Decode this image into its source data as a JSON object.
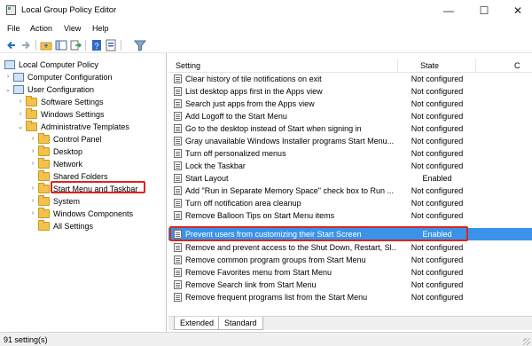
{
  "window": {
    "title": "Local Group Policy Editor",
    "minimize": "—",
    "maximize": "☐",
    "close": "✕"
  },
  "menu": [
    "File",
    "Action",
    "View",
    "Help"
  ],
  "toolbar": [
    "back-icon",
    "forward-icon",
    "folder-up-icon",
    "show-hide-tree-icon",
    "export-list-icon",
    "help-icon",
    "properties-icon",
    "filter-icon"
  ],
  "tree": {
    "root": "Local Computer Policy",
    "items": [
      {
        "label": "Computer Configuration",
        "caret": "›",
        "icon": "computer-icon"
      },
      {
        "label": "User Configuration",
        "caret": "⌄",
        "icon": "computer-icon"
      },
      {
        "label": "Software Settings",
        "caret": "›",
        "icon": "folder-icon"
      },
      {
        "label": "Windows Settings",
        "caret": "›",
        "icon": "folder-icon"
      },
      {
        "label": "Administrative Templates",
        "caret": "⌄",
        "icon": "folder-icon"
      },
      {
        "label": "Control Panel",
        "caret": "›",
        "icon": "folder-icon"
      },
      {
        "label": "Desktop",
        "caret": "›",
        "icon": "folder-icon"
      },
      {
        "label": "Network",
        "caret": "›",
        "icon": "folder-icon"
      },
      {
        "label": "Shared Folders",
        "caret": "",
        "icon": "folder-icon"
      },
      {
        "label": "Start Menu and Taskbar",
        "caret": "›",
        "icon": "folder-icon"
      },
      {
        "label": "System",
        "caret": "›",
        "icon": "folder-icon"
      },
      {
        "label": "Windows Components",
        "caret": "›",
        "icon": "folder-icon"
      },
      {
        "label": "All Settings",
        "caret": "",
        "icon": "folder-icon"
      }
    ]
  },
  "list": {
    "headers": {
      "setting": "Setting",
      "state": "State",
      "comment": "C"
    },
    "rows": [
      {
        "name": "Clear history of tile notifications on exit",
        "state": "Not configured"
      },
      {
        "name": "List desktop apps first in the Apps view",
        "state": "Not configured"
      },
      {
        "name": "Search just apps from the Apps view",
        "state": "Not configured"
      },
      {
        "name": "Add Logoff to the Start Menu",
        "state": "Not configured"
      },
      {
        "name": "Go to the desktop instead of Start when signing in",
        "state": "Not configured"
      },
      {
        "name": "Gray unavailable Windows Installer programs Start Menu...",
        "state": "Not configured"
      },
      {
        "name": "Turn off personalized menus",
        "state": "Not configured"
      },
      {
        "name": "Lock the Taskbar",
        "state": "Not configured"
      },
      {
        "name": "Start Layout",
        "state": "Enabled"
      },
      {
        "name": "Add \"Run in Separate Memory Space\" check box to Run ...",
        "state": "Not configured"
      },
      {
        "name": "Turn off notification area cleanup",
        "state": "Not configured"
      },
      {
        "name": "Remove Balloon Tips on Start Menu items",
        "state": "Not configured"
      },
      {
        "name": "Prevent users from customizing their Start Screen",
        "state": "Enabled"
      },
      {
        "name": "Remove and prevent access to the Shut Down, Restart, Sl...",
        "state": "Not configured"
      },
      {
        "name": "Remove common program groups from Start Menu",
        "state": "Not configured"
      },
      {
        "name": "Remove Favorites menu from Start Menu",
        "state": "Not configured"
      },
      {
        "name": "Remove Search link from Start Menu",
        "state": "Not configured"
      },
      {
        "name": "Remove frequent programs list from the Start Menu",
        "state": "Not configured"
      }
    ]
  },
  "tabs": [
    "Extended",
    "Standard"
  ],
  "status": "91 setting(s)",
  "colors": {
    "selection": "#3a93e8",
    "highlight_border": "#d9261c",
    "folder": "#f2c24b"
  }
}
